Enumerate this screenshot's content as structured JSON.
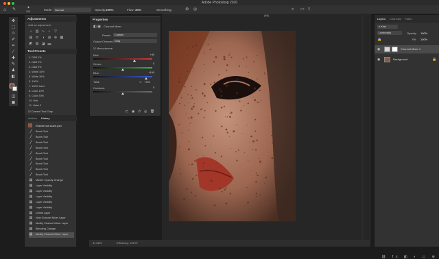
{
  "app_title": "Adobe Photoshop 2020",
  "options_bar": {
    "mode_label": "Mode:",
    "mode_value": "Normal",
    "opacity_label": "Opacity:",
    "opacity_value": "100%",
    "flow_label": "Flow:",
    "flow_value": "30%",
    "smoothing_label": "Smoothing:",
    "brush_size": "100"
  },
  "adjustments": {
    "title": "Adjustments",
    "subtitle": "Add an adjustment"
  },
  "tool_presets": {
    "title": "Tool Presets",
    "items": [
      "1. D&B 1%",
      "2. D&B 2%",
      "3. D&B 3%",
      "4. White 10%",
      "5. White 30%",
      "6. 100%",
      "7. 100% hard",
      "8. Color 10%",
      "9. Color 30%",
      "10. Hair",
      "11. Hairs 2"
    ],
    "current_tool_only": "Current Tool Only"
  },
  "history": {
    "tabs": [
      "Actions",
      "History"
    ],
    "snapshot": "Elisebe wa scars.psd",
    "items": [
      "Brush Tool",
      "Brush Tool",
      "Brush Tool",
      "Brush Tool",
      "Brush Tool",
      "Brush Tool",
      "Brush Tool",
      "Brush Tool",
      "Brush Tool",
      "Master Opacity Change",
      "Layer Visibility",
      "Layer Visibility",
      "Layer Visibility",
      "Layer Visibility",
      "Layer Visibility",
      "Delete Layer",
      "New Channel Mixer Layer",
      "Modify Channel Mixer Layer",
      "Blending Change",
      "Modify Channel Mixer Layer"
    ]
  },
  "properties": {
    "title": "Properties",
    "layer_type": "Channel Mixer",
    "preset_label": "Preset:",
    "preset_value": "Custom",
    "output_label": "Output Channel:",
    "output_value": "Gray",
    "monochrome": "Monochrome",
    "sliders": [
      {
        "label": "Red:",
        "value": "+40",
        "level": 0.7,
        "track": "#d23a3a"
      },
      {
        "label": "Green:",
        "value": "0",
        "level": 0.5,
        "track": "#3cb43c"
      },
      {
        "label": "Blue:",
        "value": "+160",
        "level": 0.9,
        "track": "#3a5ad2"
      },
      {
        "label": "Constant:",
        "value": "0",
        "level": 0.5,
        "track": "#6e6e6e"
      }
    ],
    "total_label": "Total:",
    "total_value": "+250"
  },
  "document": {
    "tab": "(8/8)",
    "zoom": "31.08%",
    "efficiency": "Efficiency: 100%*"
  },
  "layers": {
    "tabs": [
      "Layers",
      "Channels",
      "Paths"
    ],
    "kind_label": "Kind",
    "blend_mode": "Luminosity",
    "opacity_label": "Opacity:",
    "opacity_value": "100%",
    "fill_label": "Fill:",
    "fill_value": "100%",
    "items": [
      {
        "name": "Channel Mixer 1",
        "selected": true
      },
      {
        "name": "Background",
        "selected": false
      }
    ]
  },
  "colors": {
    "window_dots": [
      "#ff5f57",
      "#febc2e",
      "#28c840"
    ],
    "foreground": "#7a4636",
    "background": "#f2f2f2"
  }
}
